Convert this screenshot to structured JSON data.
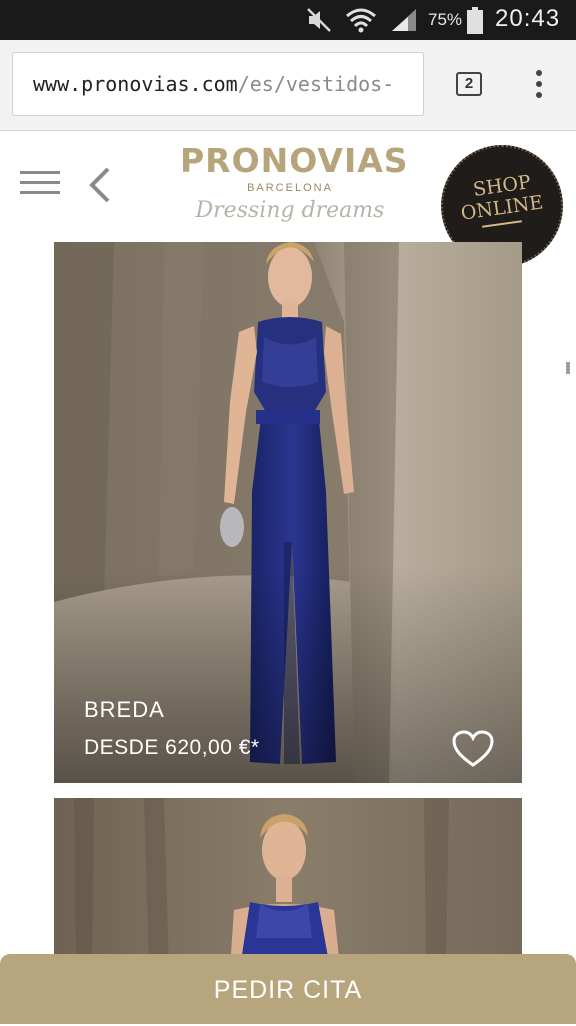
{
  "status_bar": {
    "battery_percent": "75%",
    "time": "20:43",
    "icons": [
      "mute-icon",
      "wifi-icon",
      "signal-icon",
      "battery-icon"
    ]
  },
  "browser": {
    "url_host": "www.pronovias.com",
    "url_path": "/es/vestidos-",
    "tab_count": "2"
  },
  "header": {
    "brand": "PRONOVIAS",
    "location": "BARCELONA",
    "tagline": "Dressing dreams",
    "shop_badge_line1": "SHOP",
    "shop_badge_line2": "ONLINE"
  },
  "products": [
    {
      "name": "BREDA",
      "price": "DESDE 620,00 €*"
    }
  ],
  "cta": {
    "label": "PEDIR CITA"
  },
  "colors": {
    "brand_gold": "#b6a47a",
    "cta_bg": "#b7a67d",
    "dress_navy": "#1f2a7a"
  }
}
